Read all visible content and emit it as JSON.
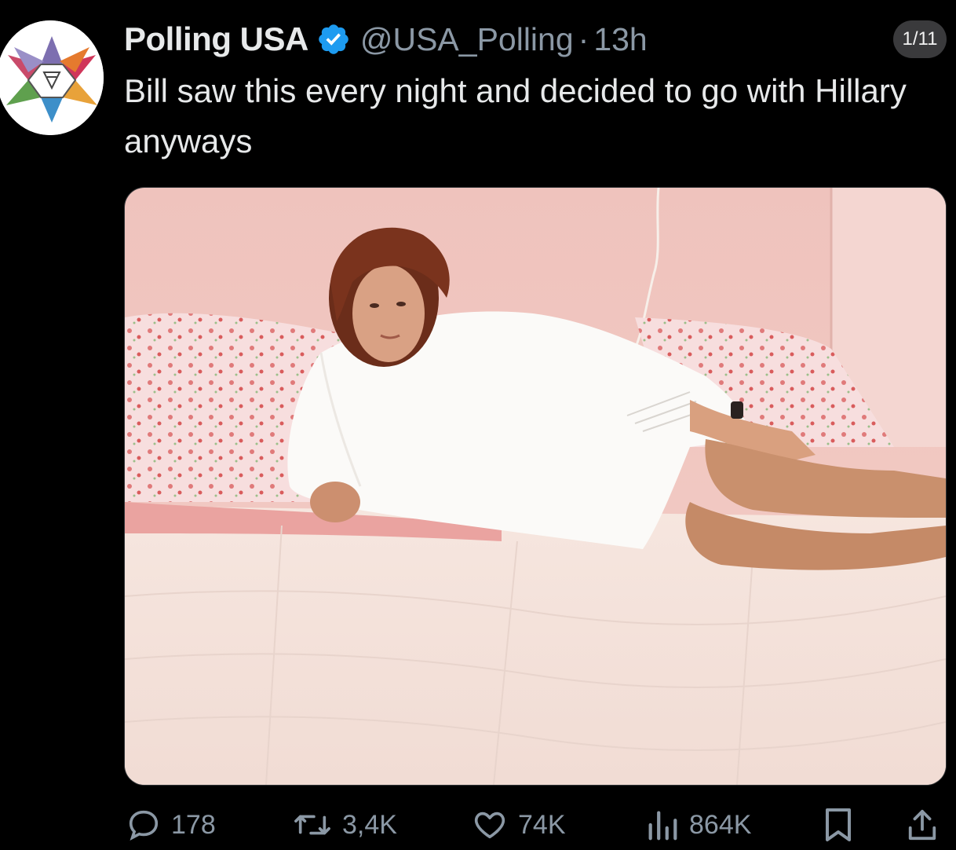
{
  "author": {
    "display_name": "Polling USA",
    "handle": "@USA_Polling",
    "separator": "·",
    "timestamp": "13h",
    "verified_icon": "verified-badge-icon"
  },
  "page_indicator": "1/11",
  "tweet": {
    "text": "Bill saw this every night and decided to go with Hillary anyways"
  },
  "media": {
    "icon": "photo"
  },
  "actions": {
    "reply_count": "178",
    "retweet_count": "3,4K",
    "like_count": "74K",
    "view_count": "864K"
  },
  "colors": {
    "background": "#000000",
    "text_primary": "#e7e9ea",
    "text_secondary": "#8b98a5",
    "verified_blue": "#1d9bf0"
  }
}
